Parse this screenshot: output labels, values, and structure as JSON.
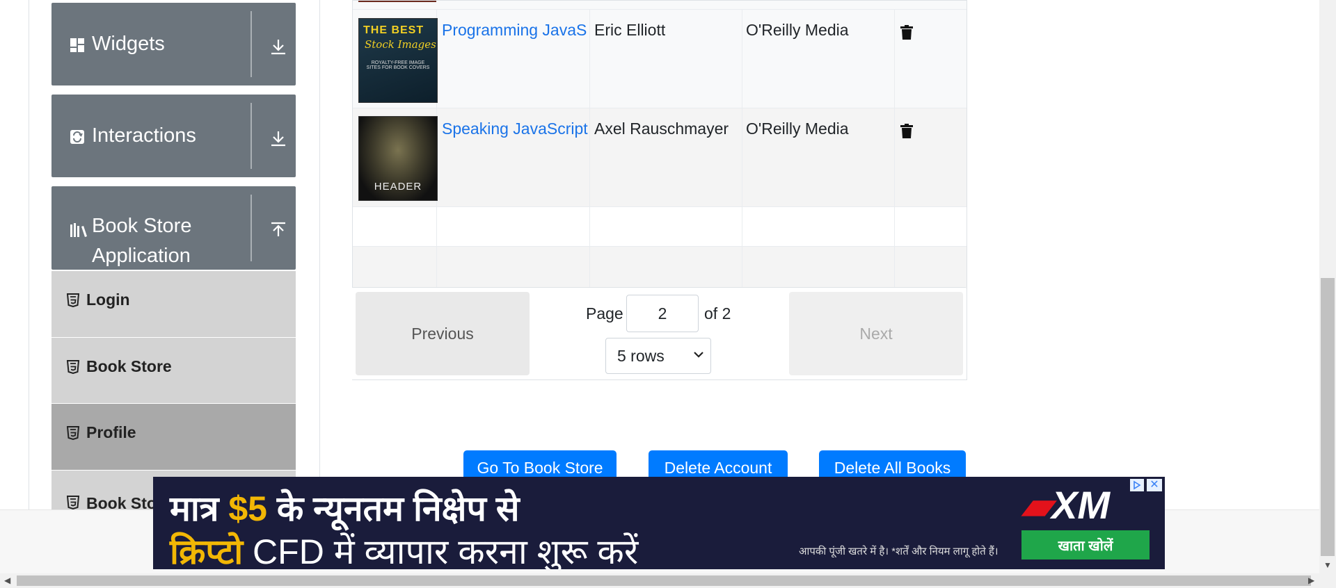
{
  "sidebar": {
    "groups": [
      {
        "label": "Widgets",
        "icon": "widgets-icon",
        "toggle": "expand"
      },
      {
        "label": "Interactions",
        "icon": "interactions-icon",
        "toggle": "expand"
      },
      {
        "label_line1": "Book Store",
        "label_line2": "Application",
        "icon": "books-icon",
        "toggle": "collapse"
      }
    ],
    "items": [
      {
        "label": "Login"
      },
      {
        "label": "Book Store"
      },
      {
        "label": "Profile",
        "active": true
      },
      {
        "label": "Book Sto"
      }
    ]
  },
  "table": {
    "rows": [
      {
        "title": "Programming JavaS",
        "author": "Eric Elliott",
        "publisher": "O'Reilly Media",
        "cover_text1": "THE BEST",
        "cover_text2": "Stock Images",
        "cover_text3": "ROYALTY-FREE IMAGE SITES FOR BOOK COVERS"
      },
      {
        "title": "Speaking JavaScript",
        "author": "Axel Rauschmayer",
        "publisher": "O'Reilly Media",
        "cover_text1": "HEADER"
      }
    ]
  },
  "pagination": {
    "previous_label": "Previous",
    "next_label": "Next",
    "page_label": "Page",
    "page_value": "2",
    "of_label": "of 2",
    "rows_option": "5 rows"
  },
  "actions": {
    "go_to_store": "Go To Book Store",
    "delete_account": "Delete Account",
    "delete_all_books": "Delete All Books"
  },
  "ad": {
    "line1_pre": "मात्र ",
    "line1_highlight": "$5",
    "line1_post": " के न्यूनतम निक्षेप से",
    "line2_highlight": "क्रिप्टो",
    "line2_post": " CFD में  व्यापार करना शुरू करें",
    "brand": "XM",
    "disclaimer": "आपकी पूंजी खतरे में है। *शर्तें और नियम लागू होते हैं।",
    "cta": "खाता खोलें",
    "close": "✕"
  },
  "colors": {
    "link": "#1a73e8",
    "primary_button": "#007bff",
    "group_bg": "#6c757d",
    "submenu_bg": "#d3d3d3",
    "submenu_active": "#a9a9a9",
    "ad_bg": "#1a1c3b",
    "ad_highlight": "#f2b705",
    "cta_green": "#1fa64a"
  }
}
